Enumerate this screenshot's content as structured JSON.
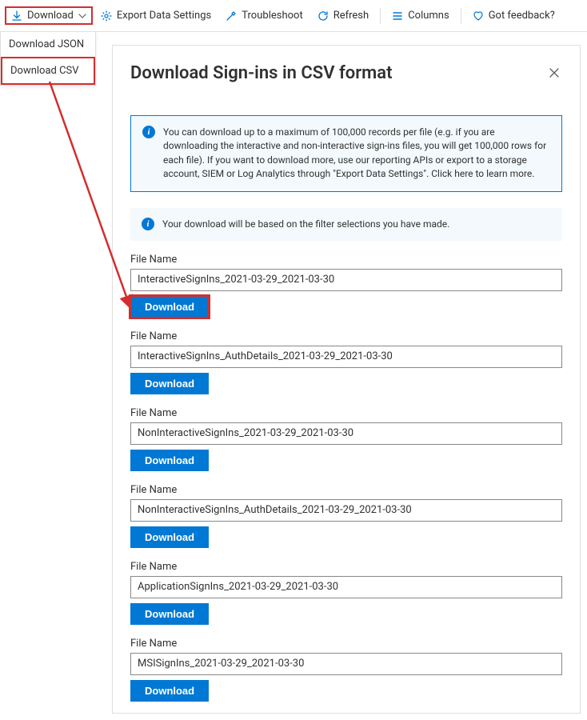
{
  "toolbar": {
    "download": "Download",
    "download_json": "Download JSON",
    "download_csv": "Download CSV",
    "export_settings": "Export Data Settings",
    "troubleshoot": "Troubleshoot",
    "refresh": "Refresh",
    "columns": "Columns",
    "feedback": "Got feedback?"
  },
  "panel": {
    "title": "Download Sign-ins in CSV format",
    "info1": "You can download up to a maximum of 100,000 records per file (e.g. if you are downloading the interactive and non-interactive sign-ins files, you will get 100,000 rows for each file).  If you want to download more, use our reporting APIs or export to a storage account, SIEM or Log Analytics through \"Export Data Settings\". Click here to learn more.",
    "info2": "Your download will be based on the filter selections you have made.",
    "filename_label": "File Name",
    "download_btn": "Download",
    "files": [
      {
        "name": "InteractiveSignIns_2021-03-29_2021-03-30"
      },
      {
        "name": "InteractiveSignIns_AuthDetails_2021-03-29_2021-03-30"
      },
      {
        "name": "NonInteractiveSignIns_2021-03-29_2021-03-30"
      },
      {
        "name": "NonInteractiveSignIns_AuthDetails_2021-03-29_2021-03-30"
      },
      {
        "name": "ApplicationSignIns_2021-03-29_2021-03-30"
      },
      {
        "name": "MSISignIns_2021-03-29_2021-03-30"
      }
    ]
  }
}
